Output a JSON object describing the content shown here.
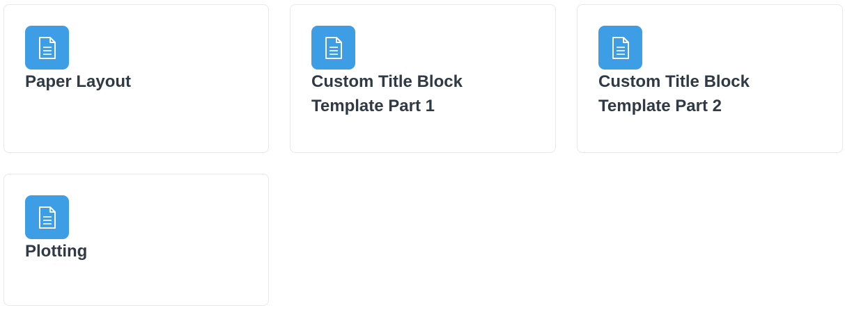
{
  "cards": [
    {
      "title": "Paper Layout",
      "icon": "document-icon"
    },
    {
      "title": "Custom Title Block Template Part 1",
      "icon": "document-icon"
    },
    {
      "title": "Custom Title Block Template Part 2",
      "icon": "document-icon"
    },
    {
      "title": "Plotting",
      "icon": "document-icon"
    }
  ],
  "colors": {
    "icon_tile": "#3d9ee5",
    "title_text": "#2f3a44",
    "card_border": "#e6e8eb"
  }
}
